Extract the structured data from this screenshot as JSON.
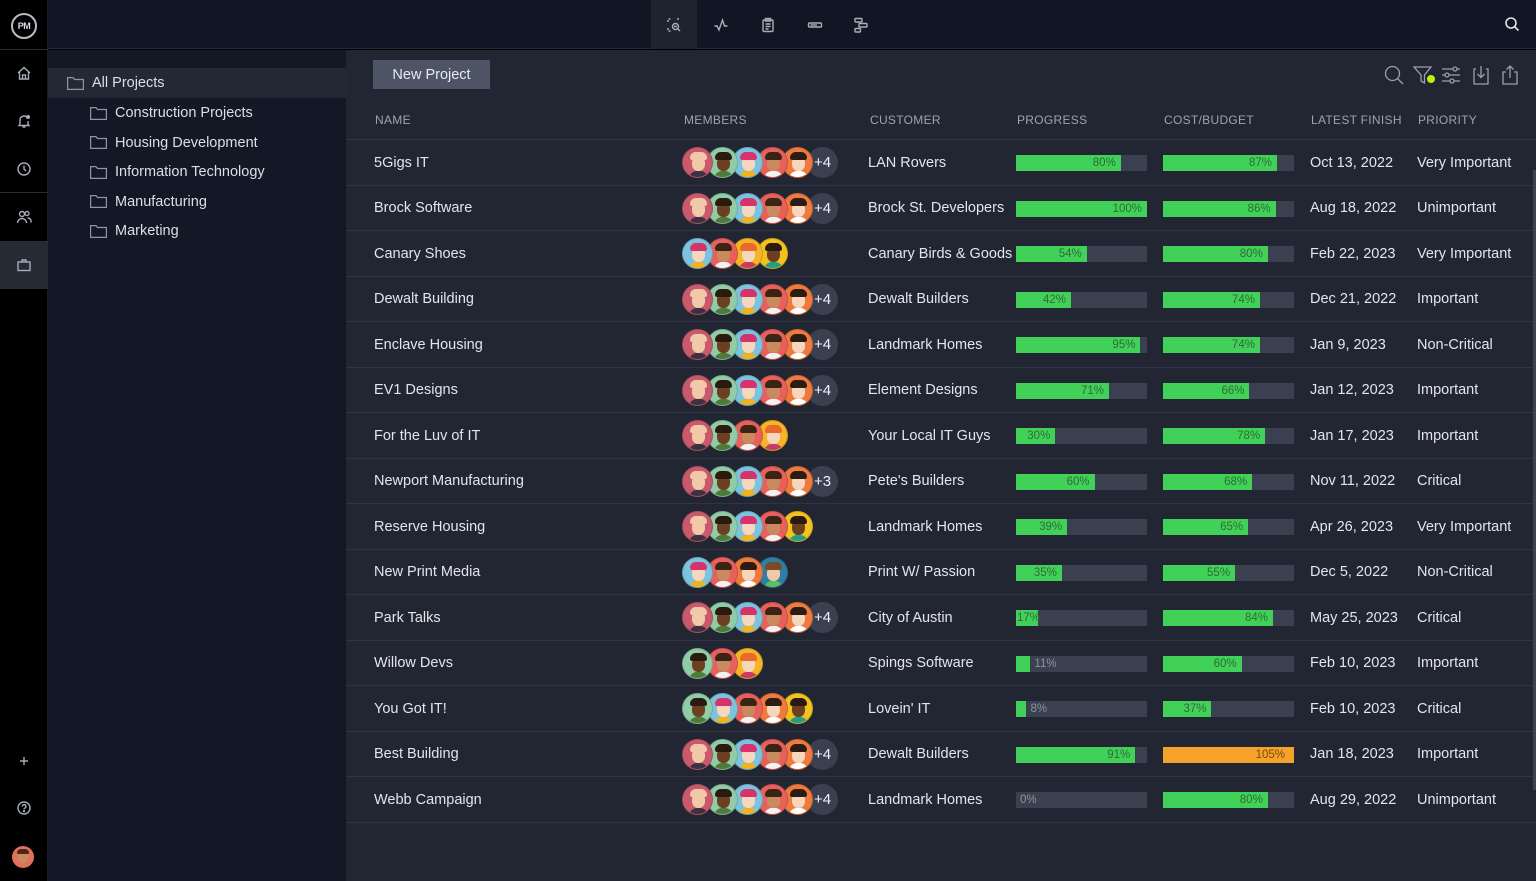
{
  "app": {
    "logo": "PM",
    "rail": [
      {
        "name": "home",
        "icon": "home-icon"
      },
      {
        "name": "notifications",
        "icon": "bell-icon"
      },
      {
        "name": "time",
        "icon": "clock-icon"
      },
      {
        "name": "team",
        "icon": "users-icon"
      },
      {
        "name": "projects",
        "icon": "briefcase-icon",
        "active": true
      }
    ],
    "rail_bottom": [
      {
        "name": "add",
        "icon": "plus-icon"
      },
      {
        "name": "help",
        "icon": "help-icon"
      },
      {
        "name": "profile",
        "icon": "avatar"
      }
    ]
  },
  "topbar": {
    "views": [
      {
        "name": "portfolio-view",
        "icon": "zoom-select-icon",
        "active": true
      },
      {
        "name": "dashboard-view",
        "icon": "pulse-icon"
      },
      {
        "name": "reports-view",
        "icon": "clipboard-icon"
      },
      {
        "name": "roadmap-view",
        "icon": "bar-icon"
      },
      {
        "name": "gantt-view",
        "icon": "gantt-icon"
      }
    ],
    "search_icon": "search-icon"
  },
  "tree": {
    "root": "All Projects",
    "folders": [
      "Construction Projects",
      "Housing Development",
      "Information Technology",
      "Manufacturing",
      "Marketing"
    ]
  },
  "toolbar": {
    "new_project_label": "New Project",
    "tools": [
      "search-icon",
      "filter-icon",
      "sliders-icon",
      "import-icon",
      "share-icon"
    ],
    "filter_active_color": "#b9f20a"
  },
  "table": {
    "columns": {
      "name": "NAME",
      "members": "MEMBERS",
      "customer": "CUSTOMER",
      "progress": "PROGRESS",
      "cost": "COST/BUDGET",
      "finish": "LATEST FINISH",
      "priority": "PRIORITY"
    },
    "colors": {
      "on_track": "#42d158",
      "over_budget": "#f5a22a",
      "track": "#3b4050"
    },
    "rows": [
      {
        "name": "5Gigs IT",
        "members": [
          "bald",
          "glasses-m",
          "pink-hair",
          "brown-m",
          "orange-f"
        ],
        "extra": "+4",
        "customer": "LAN Rovers",
        "progress": 80,
        "cost": 87,
        "finish": "Oct 13, 2022",
        "priority": "Very Important"
      },
      {
        "name": "Brock Software",
        "members": [
          "bald",
          "glasses-m",
          "pink-hair",
          "brown-m",
          "orange-f"
        ],
        "extra": "+4",
        "customer": "Brock St. Developers",
        "progress": 100,
        "cost": 86,
        "finish": "Aug 18, 2022",
        "priority": "Unimportant"
      },
      {
        "name": "Canary Shoes",
        "members": [
          "pink-hair",
          "brown-m",
          "redhead",
          "curly"
        ],
        "extra": "",
        "customer": "Canary Birds & Goods",
        "progress": 54,
        "cost": 80,
        "finish": "Feb 22, 2023",
        "priority": "Very Important"
      },
      {
        "name": "Dewalt Building",
        "members": [
          "bald",
          "glasses-m",
          "pink-hair",
          "brown-m",
          "orange-f"
        ],
        "extra": "+4",
        "customer": "Dewalt Builders",
        "progress": 42,
        "cost": 74,
        "finish": "Dec 21, 2022",
        "priority": "Important"
      },
      {
        "name": "Enclave Housing",
        "members": [
          "bald",
          "glasses-m",
          "pink-hair",
          "brown-m",
          "orange-f"
        ],
        "extra": "+4",
        "customer": "Landmark Homes",
        "progress": 95,
        "cost": 74,
        "finish": "Jan 9, 2023",
        "priority": "Non-Critical"
      },
      {
        "name": "EV1 Designs",
        "members": [
          "bald",
          "glasses-m",
          "pink-hair",
          "brown-m",
          "orange-f"
        ],
        "extra": "+4",
        "customer": "Element Designs",
        "progress": 71,
        "cost": 66,
        "finish": "Jan 12, 2023",
        "priority": "Important"
      },
      {
        "name": "For the Luv of IT",
        "members": [
          "bald",
          "glasses-m",
          "brown-m",
          "redhead"
        ],
        "extra": "",
        "customer": "Your Local IT Guys",
        "progress": 30,
        "cost": 78,
        "finish": "Jan 17, 2023",
        "priority": "Important"
      },
      {
        "name": "Newport Manufacturing",
        "members": [
          "bald",
          "glasses-m",
          "pink-hair",
          "brown-m",
          "orange-f"
        ],
        "extra": "+3",
        "customer": "Pete's Builders",
        "progress": 60,
        "cost": 68,
        "finish": "Nov 11, 2022",
        "priority": "Critical"
      },
      {
        "name": "Reserve Housing",
        "members": [
          "bald",
          "glasses-m",
          "pink-hair",
          "brown-m",
          "curly"
        ],
        "extra": "",
        "customer": "Landmark Homes",
        "progress": 39,
        "cost": 65,
        "finish": "Apr 26, 2023",
        "priority": "Very Important"
      },
      {
        "name": "New Print Media",
        "members": [
          "pink-hair",
          "brown-m",
          "orange-f",
          "blue-m"
        ],
        "extra": "",
        "customer": "Print W/ Passion",
        "progress": 35,
        "cost": 55,
        "finish": "Dec 5, 2022",
        "priority": "Non-Critical"
      },
      {
        "name": "Park Talks",
        "members": [
          "bald",
          "glasses-m",
          "pink-hair",
          "brown-m",
          "orange-f"
        ],
        "extra": "+4",
        "customer": "City of Austin",
        "progress": 17,
        "cost": 84,
        "finish": "May 25, 2023",
        "priority": "Critical"
      },
      {
        "name": "Willow Devs",
        "members": [
          "glasses-m",
          "brown-m",
          "redhead"
        ],
        "extra": "",
        "customer": "Spings Software",
        "progress": 11,
        "cost": 60,
        "finish": "Feb 10, 2023",
        "priority": "Important"
      },
      {
        "name": "You Got IT!",
        "members": [
          "glasses-m",
          "pink-hair",
          "brown-m",
          "orange-f",
          "curly"
        ],
        "extra": "",
        "customer": "Lovein' IT",
        "progress": 8,
        "cost": 37,
        "finish": "Feb 10, 2023",
        "priority": "Critical"
      },
      {
        "name": "Best Building",
        "members": [
          "bald",
          "glasses-m",
          "pink-hair",
          "brown-m",
          "orange-f"
        ],
        "extra": "+4",
        "customer": "Dewalt Builders",
        "progress": 91,
        "cost": 105,
        "finish": "Jan 18, 2023",
        "priority": "Important"
      },
      {
        "name": "Webb Campaign",
        "members": [
          "bald",
          "glasses-m",
          "pink-hair",
          "brown-m",
          "orange-f"
        ],
        "extra": "+4",
        "customer": "Landmark Homes",
        "progress": 0,
        "cost": 80,
        "finish": "Aug 29, 2022",
        "priority": "Unimportant"
      }
    ]
  }
}
